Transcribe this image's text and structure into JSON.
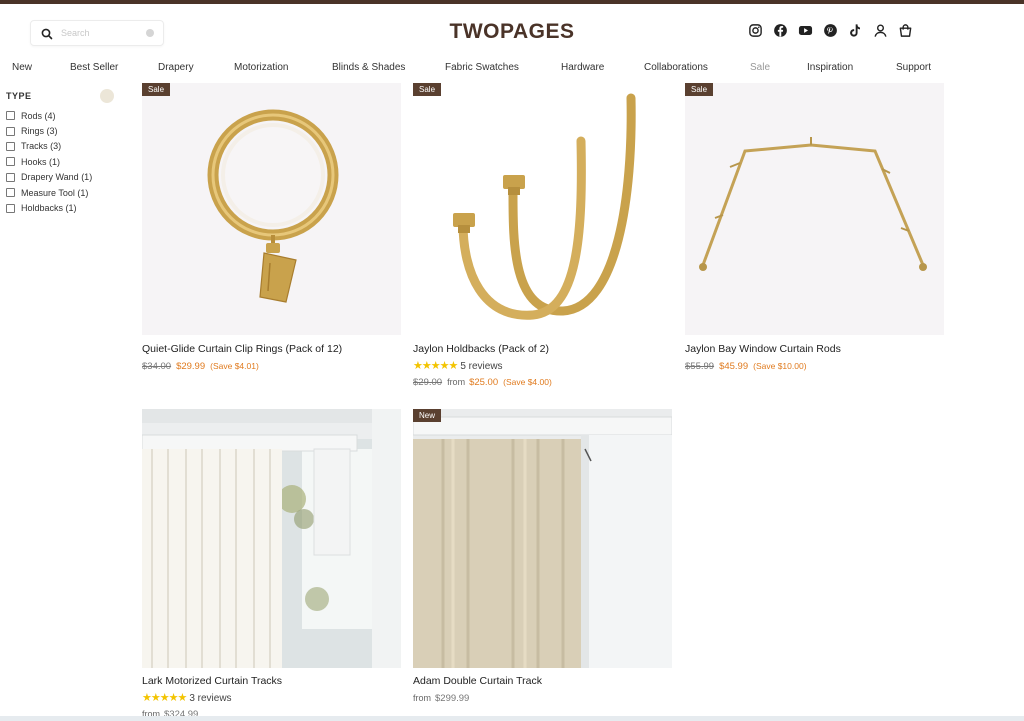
{
  "search": {
    "placeholder": "Search"
  },
  "brand": {
    "logo": "TWOPAGES",
    "color": "#4a3328"
  },
  "header_icons": [
    "instagram-icon",
    "facebook-icon",
    "youtube-icon",
    "pinterest-icon",
    "tiktok-icon",
    "account-icon",
    "cart-icon"
  ],
  "nav": [
    "New",
    "Best Seller",
    "Drapery",
    "Motorization",
    "Blinds & Shades",
    "Fabric Swatches",
    "Hardware",
    "Collaborations",
    "Sale",
    "Inspiration",
    "Support"
  ],
  "filters": {
    "title": "TYPE",
    "items": [
      "Rods (4)",
      "Rings (3)",
      "Tracks (3)",
      "Hooks (1)",
      "Drapery Wand (1)",
      "Measure Tool (1)",
      "Holdbacks (1)"
    ]
  },
  "products": [
    {
      "badge": "Sale",
      "name": "Quiet-Glide Curtain Clip Rings (Pack of 12)",
      "original_price": "$34.00",
      "price": "$29.99",
      "save": "(Save $4.01)"
    },
    {
      "badge": "Sale",
      "name": "Jaylon Holdbacks (Pack of 2)",
      "stars": "★★★★★",
      "reviews": "5 reviews",
      "original_price": "$29.00",
      "from": "from",
      "price": "$25.00",
      "save": "(Save $4.00)"
    },
    {
      "badge": "Sale",
      "name": "Jaylon Bay Window Curtain Rods",
      "original_price": "$55.99",
      "price": "$45.99",
      "save": "(Save $10.00)"
    },
    {
      "name": "Lark Motorized Curtain Tracks",
      "stars": "★★★★★",
      "reviews": "3 reviews",
      "from": "from",
      "price": "$324.99"
    },
    {
      "badge": "New",
      "name": "Adam Double Curtain Track",
      "from": "from",
      "price": "$299.99"
    }
  ],
  "colors": {
    "sale": "#e07b1f",
    "badge": "#5a4030",
    "star": "#f3c400"
  }
}
